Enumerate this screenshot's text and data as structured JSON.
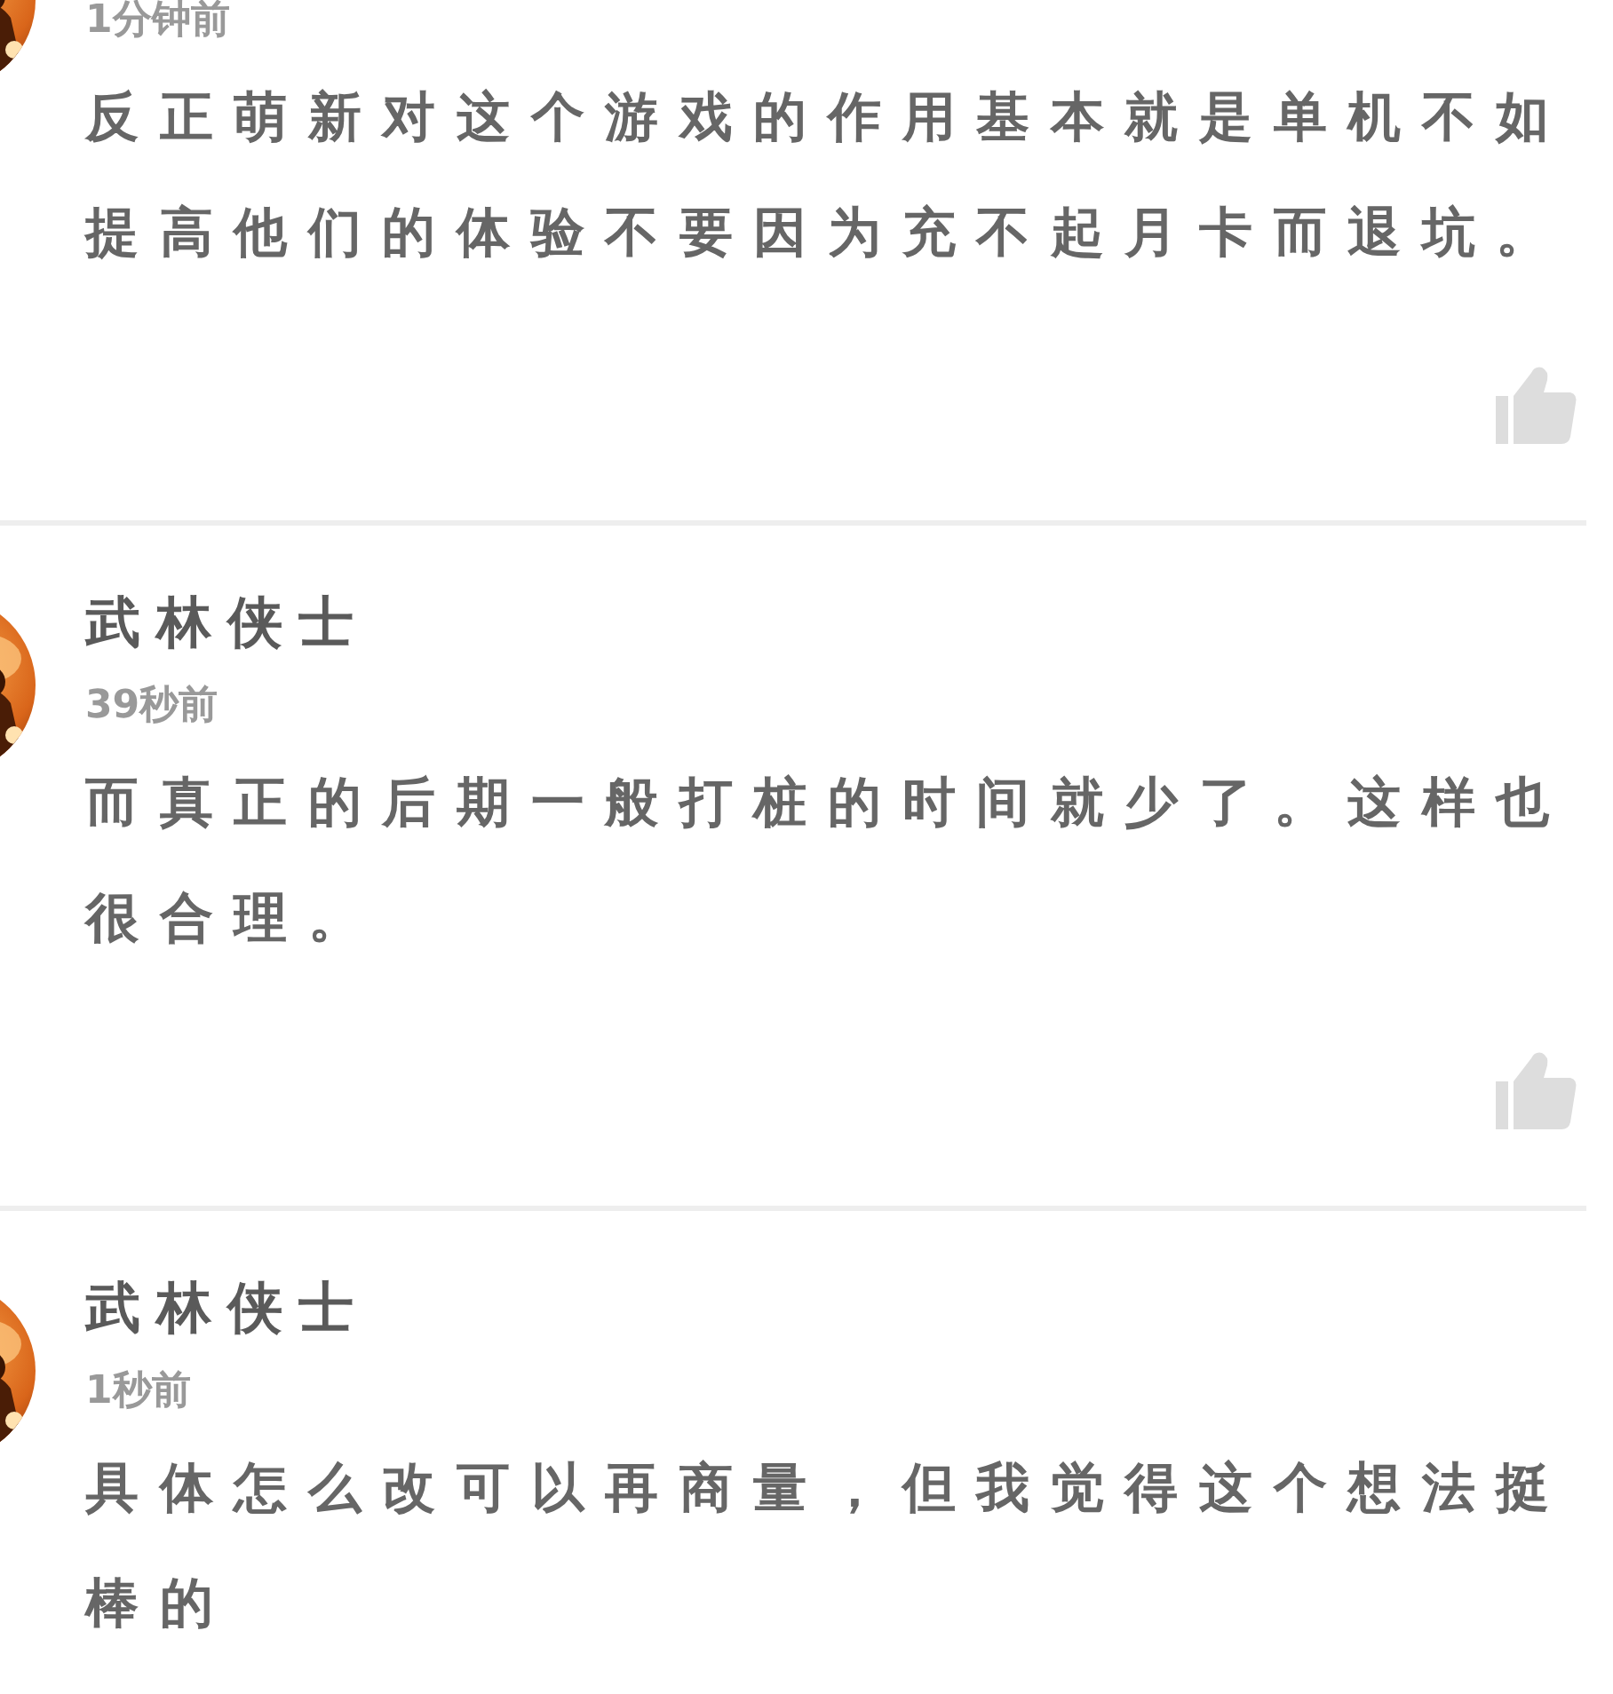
{
  "comments": [
    {
      "time": "1分钟前",
      "text": "反正萌新对这个游戏的作用基本就是单机不如提高他们的体验不要因为充不起月卡而退坑。",
      "like_button": true
    },
    {
      "name": "武林侠士",
      "time": "39秒前",
      "text": "而真正的后期一般打桩的时间就少了。这样也很合理。",
      "like_button": true
    },
    {
      "name": "武林侠士",
      "time": "1秒前",
      "text": "具体怎么改可以再商量，但我觉得这个想法挺棒的"
    }
  ]
}
